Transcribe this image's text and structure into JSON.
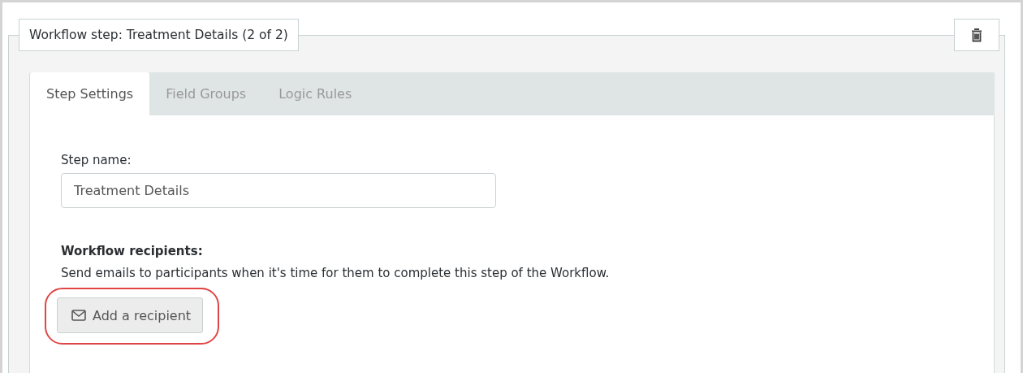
{
  "step_panel": {
    "title": "Workflow step: Treatment Details (2 of 2)",
    "tabs": [
      {
        "label": "Step Settings",
        "selected": true
      },
      {
        "label": "Field Groups",
        "selected": false
      },
      {
        "label": "Logic Rules",
        "selected": false
      }
    ],
    "step_name": {
      "label": "Step name:",
      "value": "Treatment Details"
    },
    "recipients": {
      "heading": "Workflow recipients:",
      "description": "Send emails to participants when it's time for them to complete this step of the Workflow.",
      "button": "Add a recipient",
      "highlighted": true
    }
  }
}
